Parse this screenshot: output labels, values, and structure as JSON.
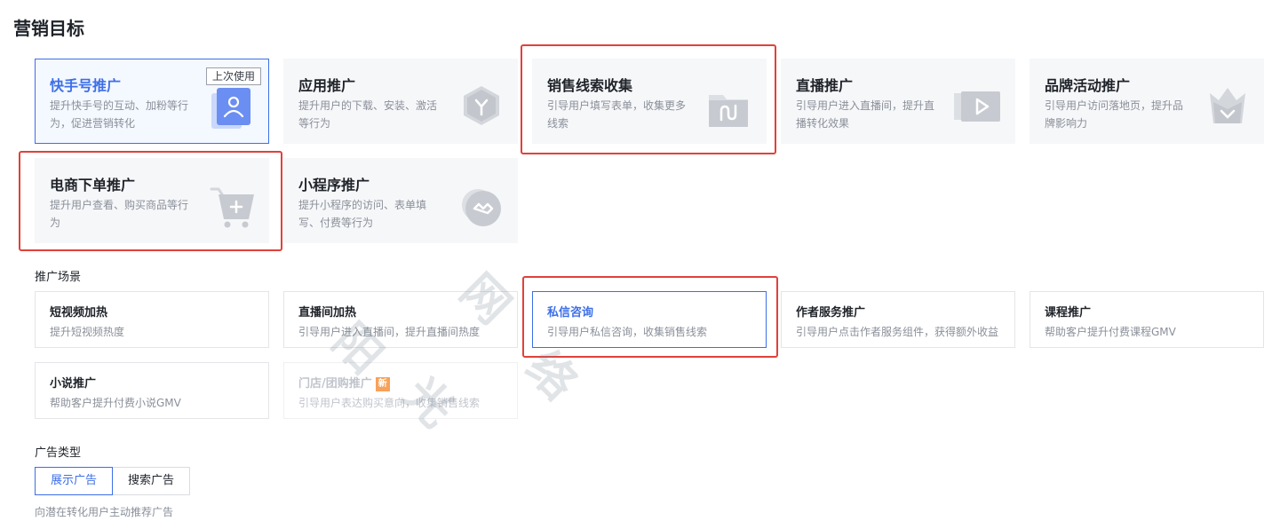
{
  "page_title": "营销目标",
  "goals": [
    {
      "title": "快手号推广",
      "desc": "提升快手号的互动、加粉等行为，促进营销转化",
      "badge": "上次使用",
      "selected": true
    },
    {
      "title": "应用推广",
      "desc": "提升用户的下载、安装、激活等行为"
    },
    {
      "title": "销售线索收集",
      "desc": "引导用户填写表单，收集更多线索"
    },
    {
      "title": "直播推广",
      "desc": "引导用户进入直播间，提升直播转化效果"
    },
    {
      "title": "品牌活动推广",
      "desc": "引导用户访问落地页，提升品牌影响力"
    },
    {
      "title": "电商下单推广",
      "desc": "提升用户查看、购买商品等行为"
    },
    {
      "title": "小程序推广",
      "desc": "提升小程序的访问、表单填写、付费等行为"
    }
  ],
  "scene_section_label": "推广场景",
  "scenes": [
    {
      "title": "短视频加热",
      "desc": "提升短视频热度"
    },
    {
      "title": "直播间加热",
      "desc": "引导用户进入直播间，提升直播间热度"
    },
    {
      "title": "私信咨询",
      "desc": "引导用户私信咨询，收集销售线索",
      "selected": true
    },
    {
      "title": "作者服务推广",
      "desc": "引导用户点击作者服务组件，获得额外收益"
    },
    {
      "title": "课程推广",
      "desc": "帮助客户提升付费课程GMV"
    },
    {
      "title": "小说推广",
      "desc": "帮助客户提升付费小说GMV"
    },
    {
      "title": "门店/团购推广",
      "desc": "引导用户表达购买意向，收集销售线索",
      "badge": "新",
      "disabled": true
    }
  ],
  "adtype_section_label": "广告类型",
  "ad_types": [
    {
      "label": "展示广告",
      "active": true
    },
    {
      "label": "搜索广告"
    }
  ],
  "ad_type_hint": "向潜在转化用户主动推荐广告",
  "watermark": [
    "阳",
    "光",
    "网",
    "络"
  ],
  "colors": {
    "accent": "#3d6fe8",
    "highlight": "#e0413b",
    "new_badge": "#f7a15a"
  }
}
